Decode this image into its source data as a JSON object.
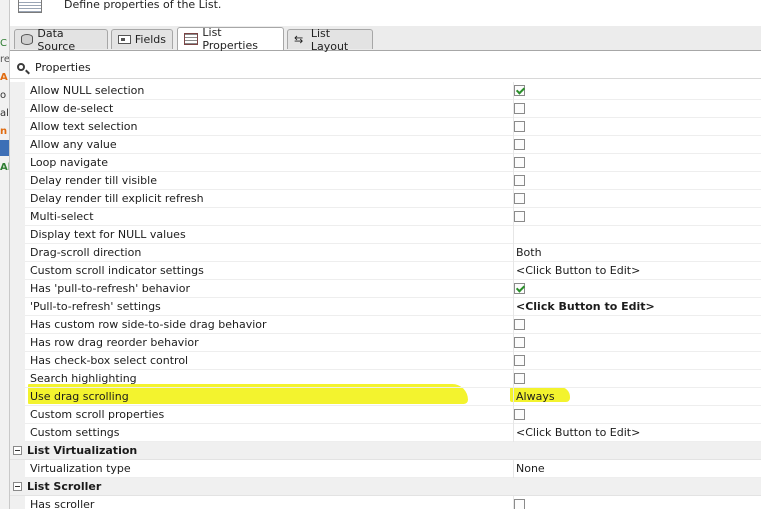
{
  "header": {
    "description": "Define properties of the List."
  },
  "tabs": [
    {
      "label": "Data Source",
      "icon": "database-icon",
      "active": false
    },
    {
      "label": "Fields",
      "icon": "fields-icon",
      "active": false
    },
    {
      "label": "List Properties",
      "icon": "list-properties-icon",
      "active": true
    },
    {
      "label": "List Layout",
      "icon": "list-layout-icon",
      "active": false
    }
  ],
  "properties_panel": {
    "title": "Properties"
  },
  "left_fragments": [
    "C",
    "re",
    "A",
    "o",
    "alu",
    "n",
    "Al"
  ],
  "properties": [
    {
      "name": "Allow NULL selection",
      "type": "checkbox",
      "checked": true
    },
    {
      "name": "Allow de-select",
      "type": "checkbox",
      "checked": false
    },
    {
      "name": "Allow text selection",
      "type": "checkbox",
      "checked": false
    },
    {
      "name": "Allow any value",
      "type": "checkbox",
      "checked": false
    },
    {
      "name": "Loop navigate",
      "type": "checkbox",
      "checked": false
    },
    {
      "name": "Delay render till visible",
      "type": "checkbox",
      "checked": false
    },
    {
      "name": "Delay render till explicit refresh",
      "type": "checkbox",
      "checked": false
    },
    {
      "name": "Multi-select",
      "type": "checkbox",
      "checked": false
    },
    {
      "name": "Display text for NULL values",
      "type": "text",
      "value": ""
    },
    {
      "name": "Drag-scroll direction",
      "type": "text",
      "value": "Both"
    },
    {
      "name": "Custom scroll indicator settings",
      "type": "text",
      "value": "<Click Button to Edit>"
    },
    {
      "name": "Has 'pull-to-refresh' behavior",
      "type": "checkbox",
      "checked": true
    },
    {
      "name": "'Pull-to-refresh' settings",
      "type": "text",
      "value": "<Click Button to Edit>",
      "bold": true
    },
    {
      "name": "Has custom row side-to-side drag behavior",
      "type": "checkbox",
      "checked": false
    },
    {
      "name": "Has row drag reorder behavior",
      "type": "checkbox",
      "checked": false
    },
    {
      "name": "Has check-box select control",
      "type": "checkbox",
      "checked": false
    },
    {
      "name": "Search highlighting",
      "type": "checkbox",
      "checked": false
    },
    {
      "name": "Use drag scrolling",
      "type": "text",
      "value": "Always",
      "highlighted": true
    },
    {
      "name": "Custom scroll properties",
      "type": "checkbox",
      "checked": false
    },
    {
      "name": "Custom settings",
      "type": "text",
      "value": "<Click Button to Edit>"
    }
  ],
  "sections": [
    {
      "title": "List Virtualization",
      "properties": [
        {
          "name": "Virtualization type",
          "type": "text",
          "value": "None"
        }
      ]
    },
    {
      "title": "List Scroller",
      "properties": [
        {
          "name": "Has scroller",
          "type": "checkbox",
          "checked": false
        }
      ]
    }
  ],
  "highlight_color": "#f3f32e",
  "check_color": "#2a8f2a"
}
